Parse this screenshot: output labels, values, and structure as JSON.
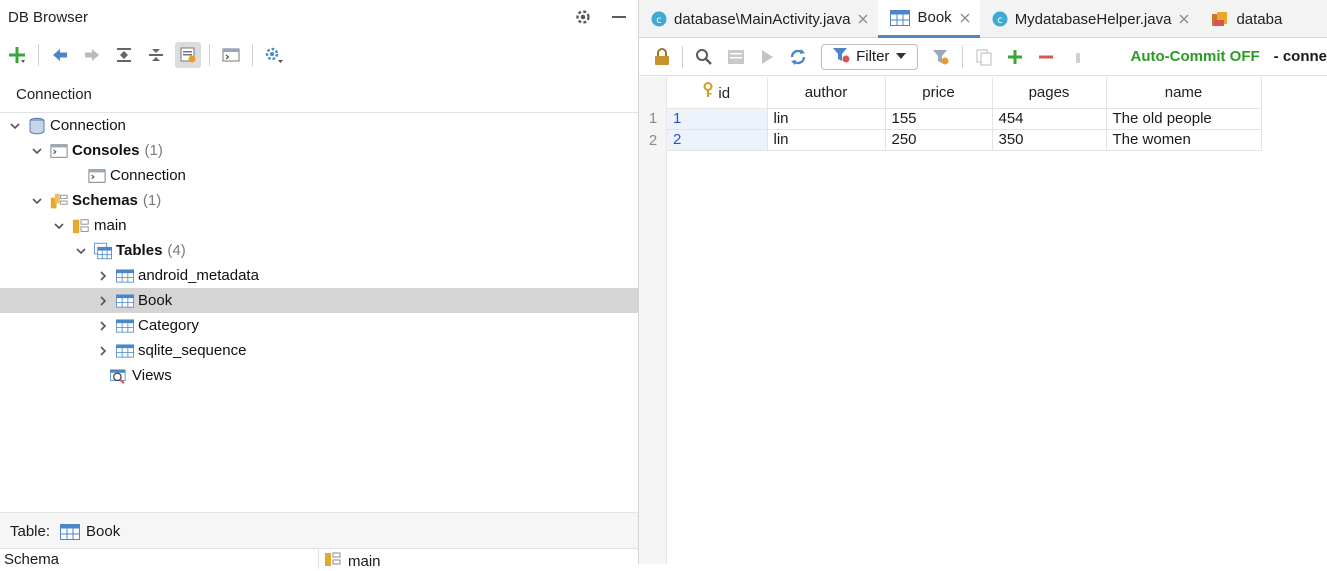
{
  "left": {
    "title": "DB Browser",
    "section": "Connection",
    "tree": [
      {
        "label": "Connection",
        "count": "",
        "bold": false,
        "icon": "database-icon"
      },
      {
        "label": "Consoles",
        "count": "(1)",
        "bold": true,
        "icon": "console-icon"
      },
      {
        "label": "Connection",
        "count": "",
        "bold": false,
        "icon": "console-icon"
      },
      {
        "label": "Schemas",
        "count": "(1)",
        "bold": true,
        "icon": "schemas-icon"
      },
      {
        "label": "main",
        "count": "",
        "bold": false,
        "icon": "schema-icon"
      },
      {
        "label": "Tables",
        "count": "(4)",
        "bold": true,
        "icon": "tables-icon"
      },
      {
        "label": "android_metadata",
        "count": "",
        "bold": false,
        "icon": "table-icon"
      },
      {
        "label": "Book",
        "count": "",
        "bold": false,
        "icon": "table-icon"
      },
      {
        "label": "Category",
        "count": "",
        "bold": false,
        "icon": "table-icon"
      },
      {
        "label": "sqlite_sequence",
        "count": "",
        "bold": false,
        "icon": "table-icon"
      },
      {
        "label": "Views",
        "count": "",
        "bold": false,
        "icon": "views-icon"
      }
    ],
    "bottom": {
      "label": "Table:",
      "value": "Book",
      "prop_key": "Schema",
      "prop_value": "main"
    }
  },
  "right": {
    "tabs": [
      {
        "label": "database\\MainActivity.java",
        "active": false
      },
      {
        "label": "Book",
        "active": true
      },
      {
        "label": "MydatabaseHelper.java",
        "active": false
      },
      {
        "label": "databa",
        "active": false
      }
    ],
    "toolbar": {
      "filter_label": "Filter",
      "autocommit": "Auto-Commit OFF",
      "connection": "- conne"
    },
    "grid": {
      "columns": [
        "id",
        "author",
        "price",
        "pages",
        "name"
      ],
      "rows": [
        {
          "num": "1",
          "cells": [
            "1",
            "lin",
            "155",
            "454",
            "The old people"
          ]
        },
        {
          "num": "2",
          "cells": [
            "2",
            "lin",
            "250",
            "350",
            "The women"
          ]
        }
      ]
    }
  },
  "colors": {
    "accent": "#4a86c8",
    "autocommit": "#2d9a23",
    "selection": "#d5d5d5",
    "add": "#3aa33a",
    "remove": "#d9534f"
  }
}
